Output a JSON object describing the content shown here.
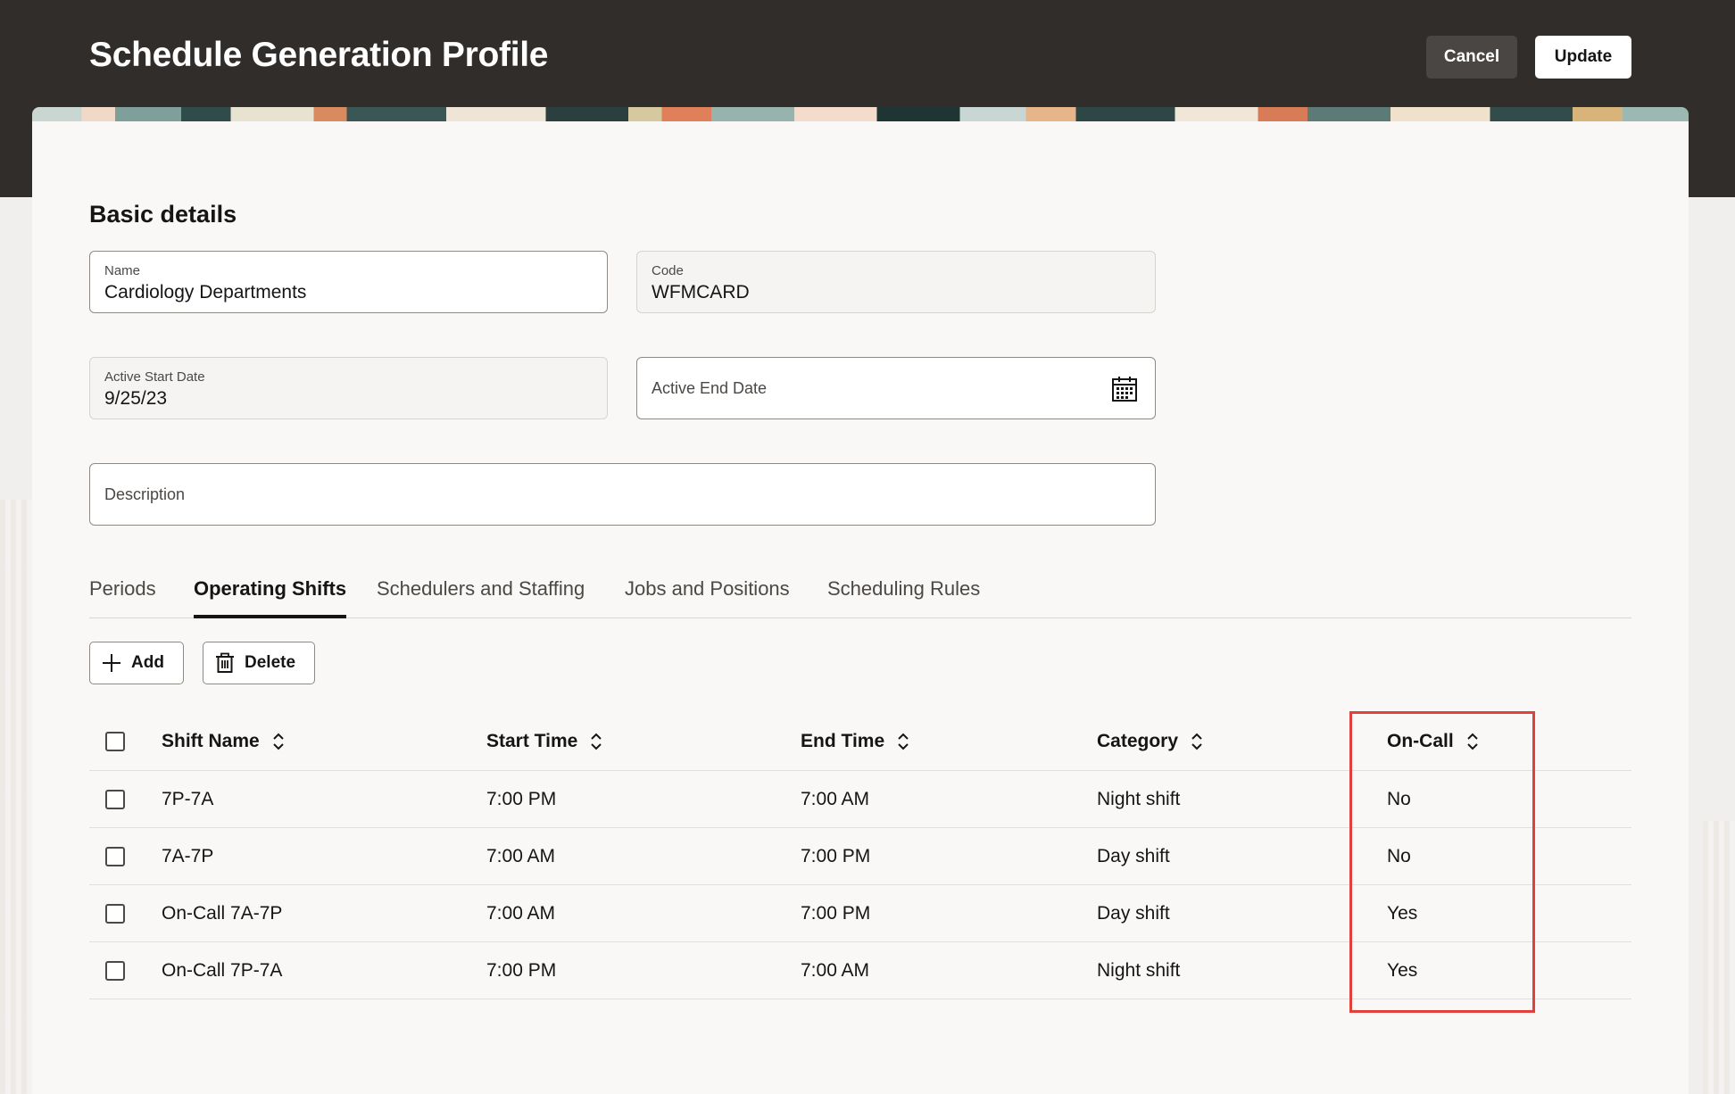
{
  "header": {
    "title": "Schedule Generation Profile",
    "cancel_label": "Cancel",
    "update_label": "Update"
  },
  "basic_details": {
    "section_title": "Basic details",
    "name": {
      "label": "Name",
      "value": "Cardiology Departments"
    },
    "code": {
      "label": "Code",
      "value": "WFMCARD"
    },
    "active_start_date": {
      "label": "Active Start Date",
      "value": "9/25/23"
    },
    "active_end_date": {
      "label": "Active End Date",
      "value": ""
    },
    "description": {
      "label": "Description",
      "value": ""
    }
  },
  "tabs": [
    {
      "label": "Periods",
      "active": false
    },
    {
      "label": "Operating Shifts",
      "active": true
    },
    {
      "label": "Schedulers and Staffing",
      "active": false
    },
    {
      "label": "Jobs and Positions",
      "active": false
    },
    {
      "label": "Scheduling Rules",
      "active": false
    }
  ],
  "toolbar": {
    "add_label": "Add",
    "delete_label": "Delete"
  },
  "table": {
    "columns": [
      "Shift Name",
      "Start Time",
      "End Time",
      "Category",
      "On-Call"
    ],
    "rows": [
      {
        "shift_name": "7P-7A",
        "start_time": "7:00 PM",
        "end_time": "7:00 AM",
        "category": "Night shift",
        "on_call": "No"
      },
      {
        "shift_name": "7A-7P",
        "start_time": "7:00 AM",
        "end_time": "7:00 PM",
        "category": "Day shift",
        "on_call": "No"
      },
      {
        "shift_name": "On-Call 7A-7P",
        "start_time": "7:00 AM",
        "end_time": "7:00 PM",
        "category": "Day shift",
        "on_call": "Yes"
      },
      {
        "shift_name": "On-Call 7P-7A",
        "start_time": "7:00 PM",
        "end_time": "7:00 AM",
        "category": "Night shift",
        "on_call": "Yes"
      }
    ]
  },
  "colors": {
    "header_bg": "#312d2a",
    "highlight": "#e0413a"
  }
}
